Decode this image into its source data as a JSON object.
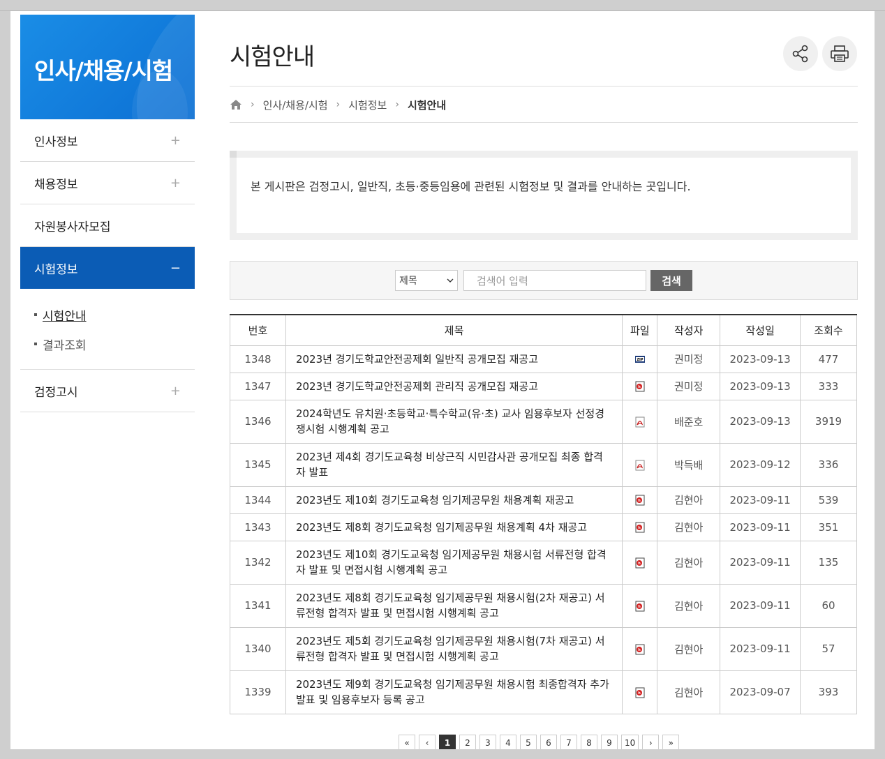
{
  "sidebar": {
    "title": "인사/채용/시험",
    "items": [
      {
        "label": "인사정보",
        "toggle": "+"
      },
      {
        "label": "채용정보",
        "toggle": "+"
      },
      {
        "label": "자원봉사자모집",
        "toggle": ""
      },
      {
        "label": "시험정보",
        "toggle": "−"
      },
      {
        "label": "검정고시",
        "toggle": "+"
      }
    ],
    "submenu": [
      {
        "label": "시험안내"
      },
      {
        "label": "결과조회"
      }
    ]
  },
  "header": {
    "title": "시험안내",
    "share_icon": "share-icon",
    "print_icon": "print-icon"
  },
  "breadcrumb": {
    "home_icon": "home-icon",
    "items": [
      "인사/채용/시험",
      "시험정보",
      "시험안내"
    ]
  },
  "intro": {
    "text": "본 게시판은 검정고시, 일반직, 초등·중등임용에 관련된 시험정보 및 결과를 안내하는 곳입니다."
  },
  "search": {
    "select_value": "제목",
    "placeholder": "검색어 입력",
    "button_label": "검색"
  },
  "table": {
    "headers": [
      "번호",
      "제목",
      "파일",
      "작성자",
      "작성일",
      "조회수"
    ],
    "rows": [
      {
        "no": "1348",
        "title": "2023년 경기도학교안전공제회 일반직 공개모집 재공고",
        "file": "zip",
        "author": "권미정",
        "date": "2023-09-13",
        "views": "477"
      },
      {
        "no": "1347",
        "title": "2023년 경기도학교안전공제회 관리직 공개모집 재공고",
        "file": "hwp",
        "author": "권미정",
        "date": "2023-09-13",
        "views": "333"
      },
      {
        "no": "1346",
        "title": "2024학년도 유치원·초등학교·특수학교(유·초) 교사 임용후보자 선정경쟁시험 시행계획 공고",
        "file": "pdf",
        "author": "배준호",
        "date": "2023-09-13",
        "views": "3919"
      },
      {
        "no": "1345",
        "title": "2023년 제4회 경기도교육청 비상근직 시민감사관 공개모집 최종 합격자 발표",
        "file": "pdf",
        "author": "박득배",
        "date": "2023-09-12",
        "views": "336"
      },
      {
        "no": "1344",
        "title": "2023년도 제10회 경기도교육청 임기제공무원 채용계획 재공고",
        "file": "hwp",
        "author": "김현아",
        "date": "2023-09-11",
        "views": "539"
      },
      {
        "no": "1343",
        "title": "2023년도 제8회 경기도교육청 임기제공무원 채용계획 4차 재공고",
        "file": "hwp",
        "author": "김현아",
        "date": "2023-09-11",
        "views": "351"
      },
      {
        "no": "1342",
        "title": "2023년도 제10회 경기도교육청 임기제공무원 채용시험 서류전형 합격자 발표 및 면접시험 시행계획 공고",
        "file": "hwp",
        "author": "김현아",
        "date": "2023-09-11",
        "views": "135"
      },
      {
        "no": "1341",
        "title": "2023년도 제8회 경기도교육청 임기제공무원 채용시험(2차 재공고) 서류전형 합격자 발표 및 면접시험 시행계획 공고",
        "file": "hwp",
        "author": "김현아",
        "date": "2023-09-11",
        "views": "60"
      },
      {
        "no": "1340",
        "title": "2023년도 제5회 경기도교육청 임기제공무원 채용시험(7차 재공고) 서류전형 합격자 발표 및 면접시험 시행계획 공고",
        "file": "hwp",
        "author": "김현아",
        "date": "2023-09-11",
        "views": "57"
      },
      {
        "no": "1339",
        "title": "2023년도 제9회 경기도교육청 임기제공무원 채용시험 최종합격자 추가 발표 및 임용후보자 등록 공고",
        "file": "hwp",
        "author": "김현아",
        "date": "2023-09-07",
        "views": "393"
      }
    ]
  },
  "pagination": {
    "first": "«",
    "prev": "‹",
    "pages": [
      "1",
      "2",
      "3",
      "4",
      "5",
      "6",
      "7",
      "8",
      "9",
      "10"
    ],
    "current": "1",
    "next": "›",
    "last": "»"
  }
}
